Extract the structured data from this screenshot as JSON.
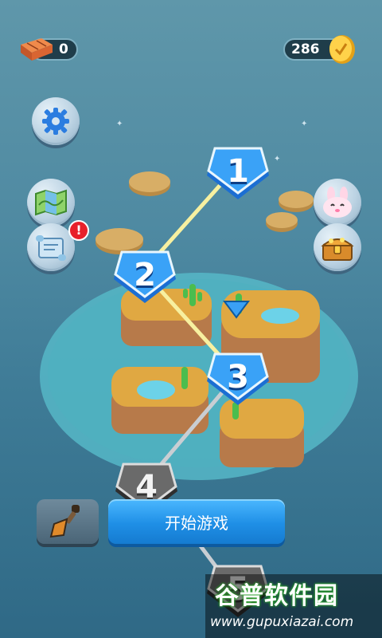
{
  "hud": {
    "bricks_count": "0",
    "coins_count": "286"
  },
  "levels": [
    {
      "number": "1",
      "state": "unlocked"
    },
    {
      "number": "2",
      "state": "unlocked"
    },
    {
      "number": "3",
      "state": "current"
    },
    {
      "number": "4",
      "state": "locked"
    },
    {
      "number": "5",
      "state": "locked"
    }
  ],
  "buttons": {
    "start_label": "开始游戏"
  },
  "alerts": {
    "scroll_badge": "!"
  },
  "watermark": {
    "title": "谷普软件园",
    "url": "www.gupuxiazai.com"
  },
  "icons": {
    "settings": "gear-icon",
    "map": "map-icon",
    "scroll": "scroll-icon",
    "rabbit": "rabbit-icon",
    "chest": "treasure-chest-icon",
    "shovel": "shovel-icon",
    "brick": "brick-icon",
    "coin": "coin-icon"
  },
  "colors": {
    "unlocked_node": "#2b8df0",
    "locked_node": "#6a6a6a",
    "start_button": "#1f8fe6",
    "path_lit": "#f7f0a0",
    "path_locked": "#c9ced3"
  }
}
